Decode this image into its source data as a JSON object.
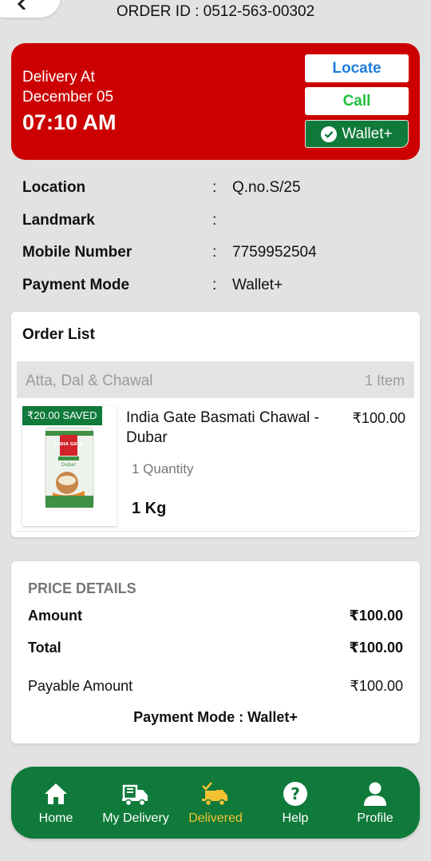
{
  "header": {
    "order_id": "ORDER ID : 0512-563-00302"
  },
  "delivery": {
    "heading": "Delivery At",
    "date": "December 05",
    "time": "07:10 AM",
    "locate_label": "Locate",
    "call_label": "Call",
    "wallet_label": "Wallet+"
  },
  "details": [
    {
      "label": "Location",
      "colon": ":",
      "value": "Q.no.S/25"
    },
    {
      "label": "Landmark",
      "colon": ":",
      "value": ""
    },
    {
      "label": "Mobile Number",
      "colon": ":",
      "value": "7759952504"
    },
    {
      "label": "Payment Mode",
      "colon": ":",
      "value": "Wallet+"
    }
  ],
  "order_list": {
    "title": "Order List",
    "category": "Atta, Dal & Chawal",
    "item_count": "1 Item",
    "product": {
      "saved": "₹20.00 SAVED",
      "name": "India Gate Basmati Chawal - Dubar",
      "price": "₹100.00",
      "quantity": "1 Quantity",
      "weight": "1 Kg",
      "package_brand": "INDIA GATE",
      "package_variant": "Dubar"
    }
  },
  "price_details": {
    "heading": "PRICE DETAILS",
    "amount_label": "Amount",
    "amount_value": "₹100.00",
    "total_label": "Total",
    "total_value": "₹100.00",
    "payable_label": "Payable Amount",
    "payable_value": "₹100.00",
    "payment_mode": "Payment Mode : Wallet+"
  },
  "nav": {
    "items": [
      {
        "label": "Home",
        "icon": "home-icon"
      },
      {
        "label": "My Delivery",
        "icon": "delivery-truck-icon"
      },
      {
        "label": "Delivered",
        "icon": "delivered-truck-icon"
      },
      {
        "label": "Help",
        "icon": "help-icon"
      },
      {
        "label": "Profile",
        "icon": "profile-icon"
      }
    ],
    "active_color": "#f2c233"
  },
  "colors": {
    "red": "#cc0000",
    "green": "#0f7a3a",
    "locate_blue": "#1e7ee0",
    "call_green": "#1fc03c"
  }
}
